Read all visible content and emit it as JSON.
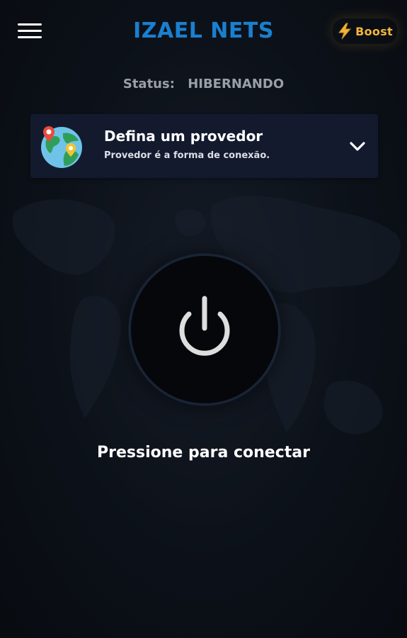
{
  "header": {
    "title": "IZAEL NETS",
    "menu_icon": "hamburger-menu-icon",
    "boost": {
      "label": "Boost",
      "icon": "lightning-bolt-icon",
      "color": "#f2b53a"
    }
  },
  "status": {
    "label": "Status:",
    "value": "HIBERNANDO"
  },
  "provider": {
    "title": "Defina um provedor",
    "subtitle": "Provedor é a forma de conexão.",
    "icon": "globe-pin-icon",
    "dropdown_icon": "chevron-down-icon"
  },
  "power": {
    "icon": "power-icon",
    "prompt": "Pressione para conectar"
  },
  "colors": {
    "accent": "#1b7fcf",
    "background": "#0c1119",
    "card": "#131a2e",
    "boost": "#f2b53a",
    "status_text": "#9aa0a8"
  }
}
